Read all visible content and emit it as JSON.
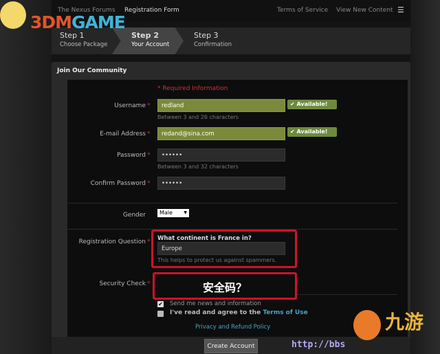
{
  "nav": {
    "forum": "The Nexus Forums",
    "current": "Registration Form",
    "tos": "Terms of Service",
    "new_content": "View New Content",
    "menu_icon": "list-icon"
  },
  "steps": [
    {
      "title": "Step 1",
      "sub": "Choose Package"
    },
    {
      "title": "Step 2",
      "sub": "Your Account"
    },
    {
      "title": "Step 3",
      "sub": "Confirmation"
    }
  ],
  "panel": {
    "title": "Join Our Community",
    "required": "* Required Information"
  },
  "form": {
    "username": {
      "label": "Username",
      "value": "redland",
      "hint": "Between 3 and 26 characters",
      "status": "✔ Available!"
    },
    "email": {
      "label": "E-mail Address",
      "value": "redand@sina.com",
      "status": "✔ Available!"
    },
    "password": {
      "label": "Password",
      "value": "••••••",
      "hint": "Between 3 and 32 characters"
    },
    "confirm": {
      "label": "Confirm Password",
      "value": "••••••"
    },
    "gender": {
      "label": "Gender",
      "value": "Male"
    },
    "question": {
      "label": "Registration Question",
      "prompt": "What continent is France in?",
      "value": "Europe",
      "hint": "This helps to protect us against spammers."
    },
    "security": {
      "label": "Security Check",
      "annotation": "安全码？"
    },
    "star": "*",
    "news": {
      "label": "Send me news and information",
      "checked": true
    },
    "terms": {
      "label": "I've read and agree to the ",
      "link": "Terms of Use",
      "checked": false
    },
    "privacy": "Privacy and Refund Policy",
    "submit": "Create Account"
  },
  "watermarks": {
    "logo1": "3DMGAME",
    "logo2": "九游",
    "url": "http://bbs"
  },
  "colors": {
    "accent": "#4aa3c8",
    "available": "#6e8a3e",
    "highlight": "#d0112b"
  }
}
